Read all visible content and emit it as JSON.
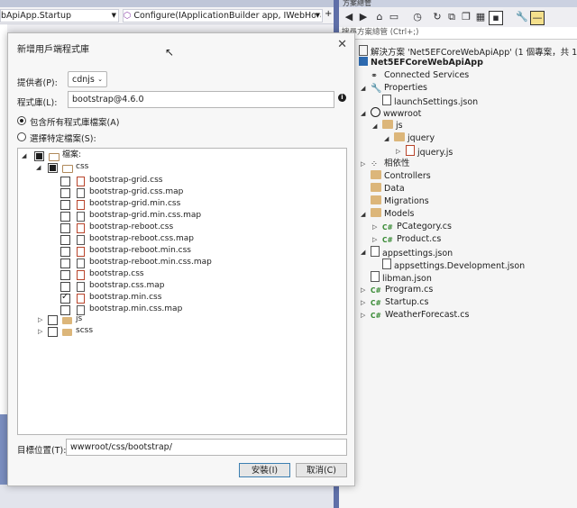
{
  "ide": {
    "nav_left": "bApiApp.Startup",
    "nav_right": "Configure(IApplicationBuilder app, IWebHos"
  },
  "solution_explorer": {
    "title": "方案總管",
    "search_placeholder": "搜尋方案總管 (Ctrl+;)",
    "items": [
      {
        "label": "解決方案 'Net5EFCoreWebApiApp' (1 個專案，共 1 個)",
        "icon": "solution-icon",
        "level": 0,
        "expand": ""
      },
      {
        "label": "Net5EFCoreWebApiApp",
        "icon": "csharp-project-icon",
        "level": 0,
        "expand": "",
        "bold": true
      },
      {
        "label": "Connected Services",
        "icon": "connected-services-icon",
        "level": 1,
        "expand": ""
      },
      {
        "label": "Properties",
        "icon": "wrench-icon",
        "level": 1,
        "expand": "▲"
      },
      {
        "label": "launchSettings.json",
        "icon": "json-file-icon",
        "level": 2,
        "expand": ""
      },
      {
        "label": "wwwroot",
        "icon": "globe-icon",
        "level": 1,
        "expand": "▲"
      },
      {
        "label": "js",
        "icon": "folder-open-icon",
        "level": 2,
        "expand": "▲"
      },
      {
        "label": "jquery",
        "icon": "folder-open-icon",
        "level": 3,
        "expand": "▲"
      },
      {
        "label": "jquery.js",
        "icon": "js-file-icon",
        "level": 4,
        "expand": "▷"
      },
      {
        "label": "相依性",
        "icon": "dependencies-icon",
        "level": 1,
        "expand": "▷"
      },
      {
        "label": "Controllers",
        "icon": "folder-icon",
        "level": 1,
        "expand": ""
      },
      {
        "label": "Data",
        "icon": "folder-icon",
        "level": 1,
        "expand": ""
      },
      {
        "label": "Migrations",
        "icon": "folder-icon",
        "level": 1,
        "expand": ""
      },
      {
        "label": "Models",
        "icon": "folder-open-icon",
        "level": 1,
        "expand": "▲"
      },
      {
        "label": "PCategory.cs",
        "icon": "cs-file-icon",
        "level": 2,
        "expand": "▷"
      },
      {
        "label": "Product.cs",
        "icon": "cs-file-icon",
        "level": 2,
        "expand": "▷"
      },
      {
        "label": "appsettings.json",
        "icon": "json-file-icon",
        "level": 1,
        "expand": "▲"
      },
      {
        "label": "appsettings.Development.json",
        "icon": "json-file-icon",
        "level": 2,
        "expand": ""
      },
      {
        "label": "libman.json",
        "icon": "json-file-icon",
        "level": 1,
        "expand": ""
      },
      {
        "label": "Program.cs",
        "icon": "cs-file-icon",
        "level": 1,
        "expand": "▷"
      },
      {
        "label": "Startup.cs",
        "icon": "cs-file-icon",
        "level": 1,
        "expand": "▷"
      },
      {
        "label": "WeatherForecast.cs",
        "icon": "cs-file-icon",
        "level": 1,
        "expand": "▷"
      }
    ]
  },
  "dialog": {
    "title": "新增用戶端程式庫",
    "provider_label": "提供者(P):",
    "provider_value": "cdnjs",
    "library_label": "程式庫(L):",
    "library_value": "bootstrap@4.6.0",
    "radio_all_label": "包含所有程式庫檔案(A)",
    "radio_specific_label": "選擇特定檔案(S):",
    "files_root": "檔案:",
    "css_folder": "css",
    "css_files": [
      {
        "name": "bootstrap-grid.css",
        "checked": false
      },
      {
        "name": "bootstrap-grid.css.map",
        "checked": false
      },
      {
        "name": "bootstrap-grid.min.css",
        "checked": false
      },
      {
        "name": "bootstrap-grid.min.css.map",
        "checked": false
      },
      {
        "name": "bootstrap-reboot.css",
        "checked": false
      },
      {
        "name": "bootstrap-reboot.css.map",
        "checked": false
      },
      {
        "name": "bootstrap-reboot.min.css",
        "checked": false
      },
      {
        "name": "bootstrap-reboot.min.css.map",
        "checked": false
      },
      {
        "name": "bootstrap.css",
        "checked": false
      },
      {
        "name": "bootstrap.css.map",
        "checked": false
      },
      {
        "name": "bootstrap.min.css",
        "checked": true
      },
      {
        "name": "bootstrap.min.css.map",
        "checked": false
      }
    ],
    "js_folder": "js",
    "scss_folder": "scss",
    "target_label": "目標位置(T):",
    "target_value": "wwwroot/css/bootstrap/",
    "install_button": "安裝(I)",
    "cancel_button": "取消(C)"
  }
}
